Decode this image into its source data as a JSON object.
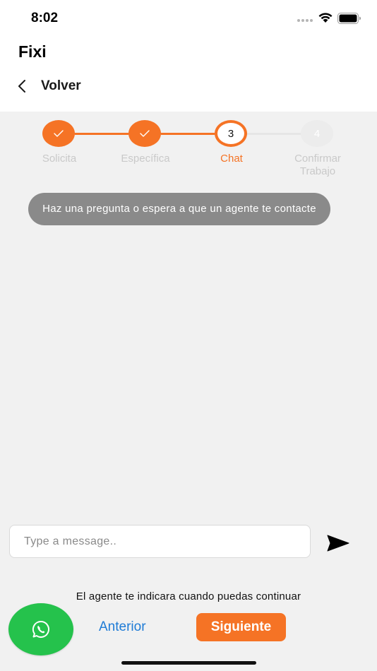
{
  "status_bar": {
    "time": "8:02"
  },
  "app": {
    "title": "Fixi"
  },
  "nav": {
    "back_label": "Volver"
  },
  "stepper": {
    "steps": [
      {
        "label": "Solicita",
        "state": "done",
        "number": ""
      },
      {
        "label": "Específica",
        "state": "done",
        "number": ""
      },
      {
        "label": "Chat",
        "state": "active",
        "number": "3"
      },
      {
        "label": "Confirmar Trabajo",
        "state": "pending",
        "number": "4"
      }
    ]
  },
  "chat": {
    "info_message": "Haz una pregunta o espera a que un agente te contacte",
    "input_value": "",
    "input_placeholder": "Type a message.."
  },
  "footer": {
    "hint": "El agente te indicara cuando puedas continuar",
    "prev_label": "Anterior",
    "next_label": "Siguiente"
  },
  "icons": {
    "wifi": "wifi-icon",
    "battery": "battery-icon",
    "back": "chevron-left-icon",
    "send": "send-icon",
    "whatsapp": "whatsapp-icon",
    "check": "check-icon"
  },
  "colors": {
    "accent": "#f57325",
    "whatsapp": "#25c24c",
    "link": "#1e7bd6",
    "pending": "#ececec",
    "bubble": "#8a8a8a",
    "background": "#f1f1f1"
  }
}
